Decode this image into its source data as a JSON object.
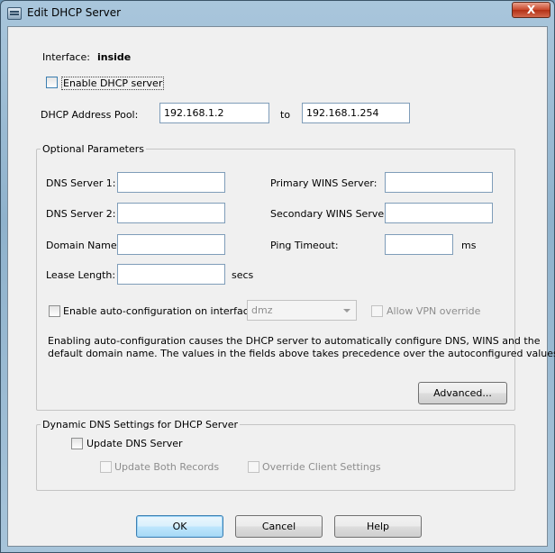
{
  "window": {
    "title": "Edit DHCP Server",
    "close_label": "X"
  },
  "interface": {
    "label": "Interface:",
    "value": "inside"
  },
  "enable_dhcp": {
    "label": "Enable DHCP server"
  },
  "pool": {
    "label": "DHCP Address Pool:",
    "from": "192.168.1.2",
    "to_label": "to",
    "to": "192.168.1.254"
  },
  "optional": {
    "legend": "Optional Parameters",
    "dns1_label": "DNS Server 1:",
    "dns2_label": "DNS Server 2:",
    "domain_label": "Domain Name:",
    "lease_label": "Lease Length:",
    "lease_unit": "secs",
    "wins1_label": "Primary WINS Server:",
    "wins2_label": "Secondary WINS Server:",
    "ping_label": "Ping Timeout:",
    "ping_unit": "ms",
    "autoconfig_label": "Enable auto-configuration on interface:",
    "autoconfig_interface": "dmz",
    "vpn_override_label": "Allow VPN override",
    "info_line1": "Enabling auto-configuration causes the DHCP server to automatically configure DNS, WINS and the",
    "info_line2": "default domain name. The values in the fields above takes precedence over the autoconfigured values.",
    "advanced_label": "Advanced..."
  },
  "ddns": {
    "legend": "Dynamic DNS Settings for DHCP Server",
    "update_dns_label": "Update DNS Server",
    "update_both_label": "Update Both Records",
    "override_client_label": "Override Client Settings"
  },
  "buttons": {
    "ok": "OK",
    "cancel": "Cancel",
    "help": "Help"
  }
}
